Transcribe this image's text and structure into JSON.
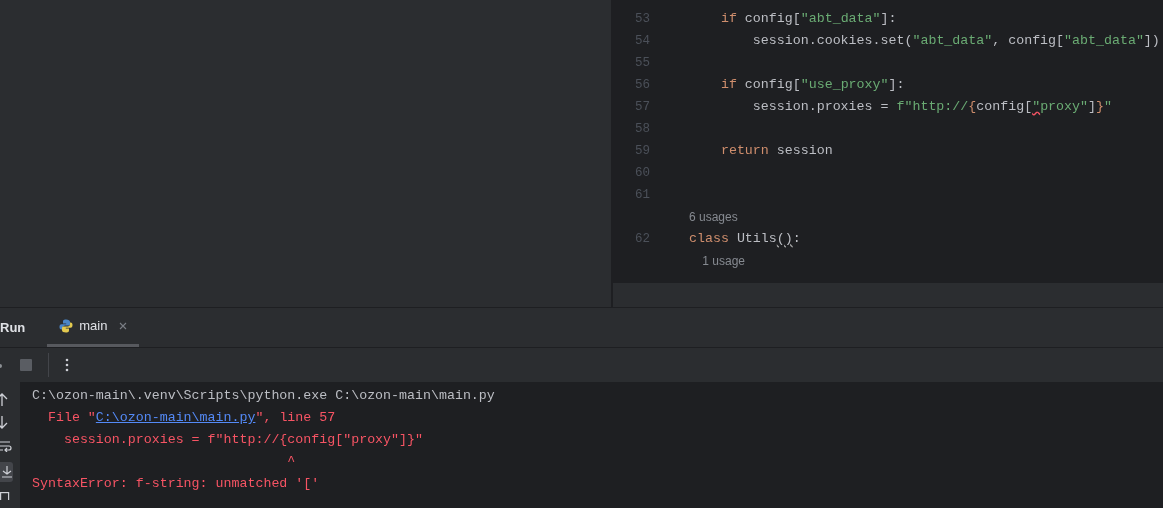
{
  "editor": {
    "lines": [
      {
        "kind": "code",
        "number": "53",
        "tokens": [
          {
            "text": "    if",
            "kind": "keyword"
          },
          {
            "text": " config["
          },
          {
            "text": "\"abt_data\"",
            "kind": "string"
          },
          {
            "text": "]:"
          }
        ]
      },
      {
        "kind": "code",
        "number": "54",
        "tokens": [
          {
            "text": "        session.cookies.set("
          },
          {
            "text": "\"abt_data\"",
            "kind": "string"
          },
          {
            "text": ", config["
          },
          {
            "text": "\"abt_data\"",
            "kind": "string"
          },
          {
            "text": "])"
          }
        ]
      },
      {
        "kind": "code",
        "number": "55"
      },
      {
        "kind": "code",
        "number": "56",
        "tokens": [
          {
            "text": "    if",
            "kind": "keyword"
          },
          {
            "text": " config["
          },
          {
            "text": "\"use_proxy\"",
            "kind": "string"
          },
          {
            "text": "]:"
          }
        ]
      },
      {
        "kind": "code",
        "number": "57",
        "tokens": [
          {
            "text": "        session.proxies = "
          },
          {
            "text": "f\"http://",
            "kind": "string"
          },
          {
            "text": "{",
            "kind": "brace"
          },
          {
            "text": "config["
          },
          {
            "text": "\"",
            "kind": "string",
            "squiggle": true
          },
          {
            "text": "proxy\"",
            "kind": "string"
          },
          {
            "text": "]"
          },
          {
            "text": "}",
            "kind": "brace"
          },
          {
            "text": "\"",
            "kind": "string"
          }
        ]
      },
      {
        "kind": "code",
        "number": "58"
      },
      {
        "kind": "code",
        "number": "59",
        "tokens": [
          {
            "text": "    return",
            "kind": "keyword"
          },
          {
            "text": " session"
          }
        ]
      },
      {
        "kind": "code",
        "number": "60"
      },
      {
        "kind": "code",
        "number": "61"
      },
      {
        "kind": "hint",
        "text": "6 usages"
      },
      {
        "kind": "code",
        "number": "62",
        "tokens": [
          {
            "text": "class",
            "kind": "keyword"
          },
          {
            "text": " Utils"
          },
          {
            "text": "()",
            "squiggle": true
          },
          {
            "text": ":"
          }
        ]
      },
      {
        "kind": "hint",
        "text": "    1 usage"
      }
    ]
  },
  "run_panel": {
    "title": "Run",
    "tabs": [
      {
        "label": "main",
        "selected": true
      }
    ]
  },
  "console": {
    "lines": [
      {
        "kind": "command",
        "segments": [
          {
            "text": "C:\\ozon-main\\.venv\\Scripts\\python.exe C:\\ozon-main\\main.py"
          }
        ]
      },
      {
        "kind": "error",
        "segments": [
          {
            "text": "  File \""
          },
          {
            "text": "C:\\ozon-main\\main.py",
            "link": true
          },
          {
            "text": "\", line 57"
          }
        ]
      },
      {
        "kind": "error",
        "segments": [
          {
            "text": "    session.proxies = f\"http://{config[\"proxy\"]}\""
          }
        ]
      },
      {
        "kind": "error",
        "segments": [
          {
            "text": "                                ^"
          }
        ]
      },
      {
        "kind": "error",
        "segments": [
          {
            "text": "SyntaxError: f-string: unmatched '['"
          }
        ]
      }
    ]
  }
}
